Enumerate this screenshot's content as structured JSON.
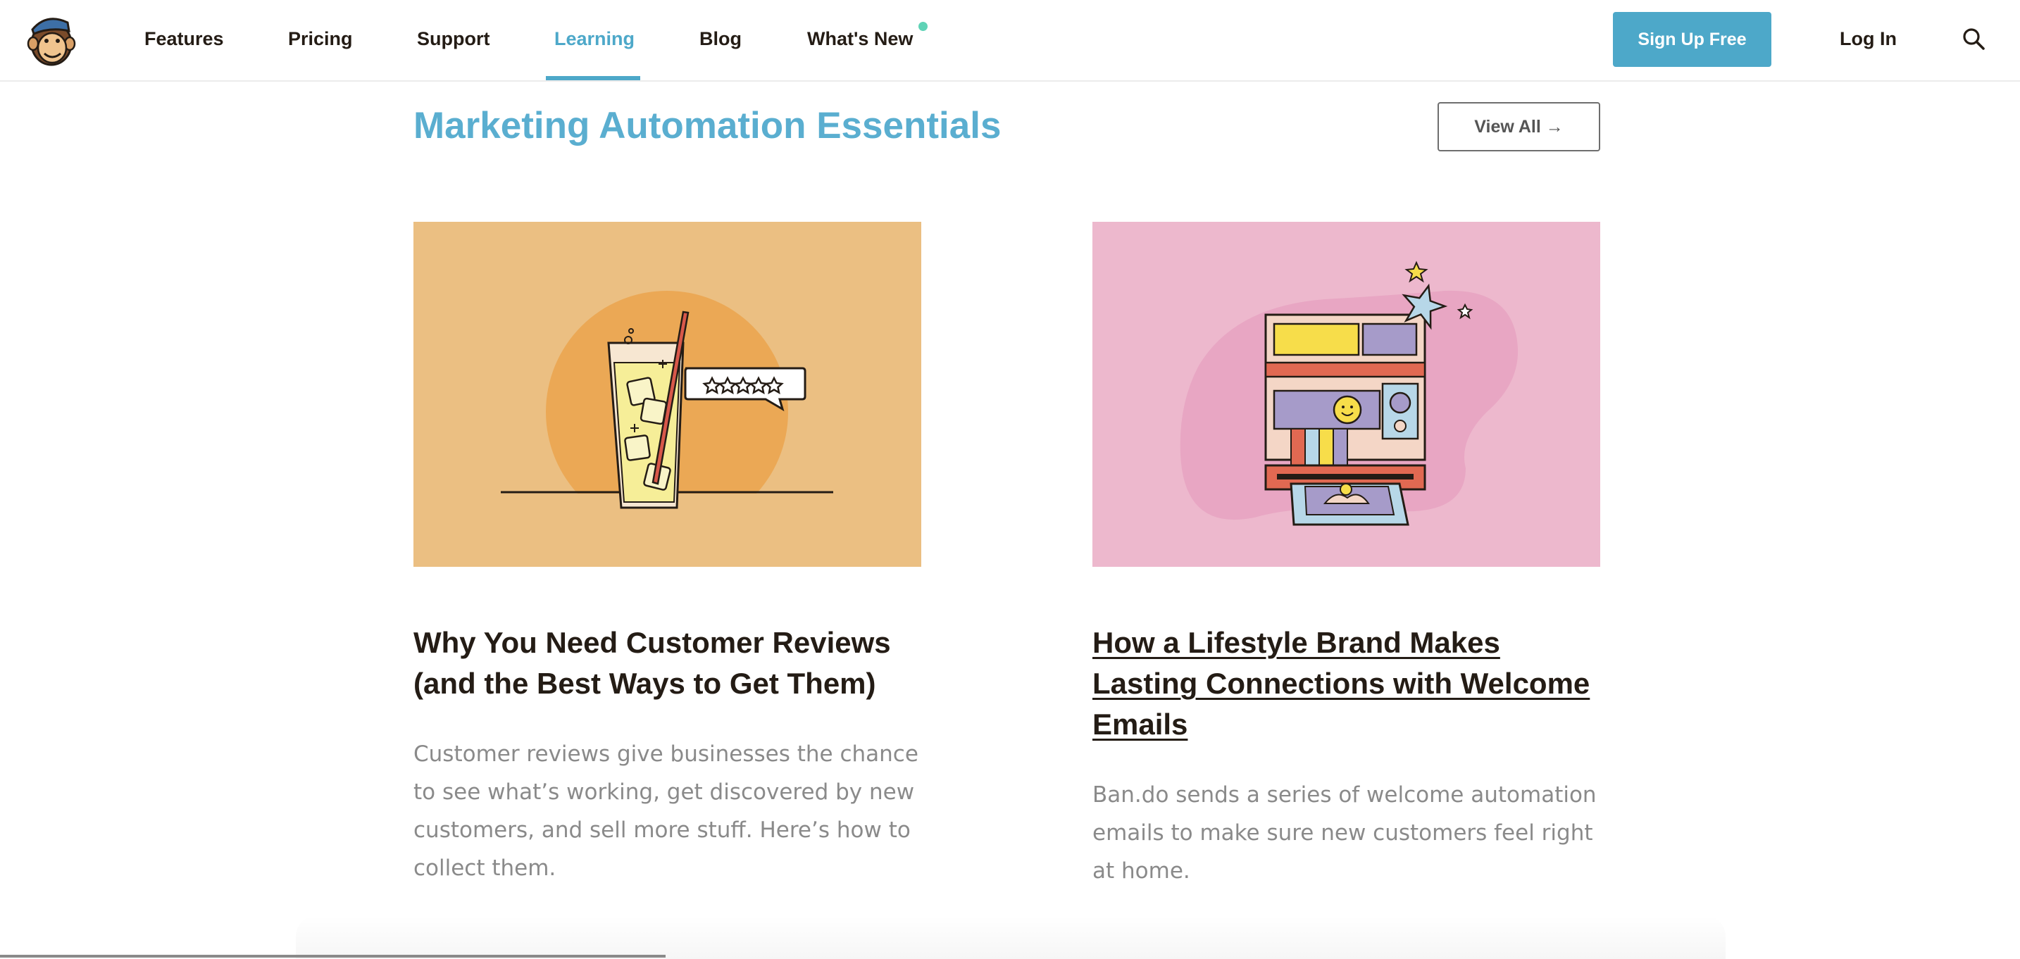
{
  "nav": {
    "logo_icon": "freddie-monkey-logo-icon",
    "links": [
      {
        "label": "Features"
      },
      {
        "label": "Pricing"
      },
      {
        "label": "Support"
      },
      {
        "label": "Learning",
        "active": true
      },
      {
        "label": "Blog"
      },
      {
        "label": "What's New",
        "has_new_dot": true
      }
    ],
    "signup_label": "Sign Up Free",
    "login_label": "Log In",
    "search_icon": "search-icon",
    "accent_color": "#4da8c9",
    "new_dot_color": "#5fd3b6"
  },
  "section": {
    "title": "Marketing Automation Essentials",
    "view_all_label": "View All →"
  },
  "cards": [
    {
      "image_icon": "lemonade-glass-with-review-stars-illustration",
      "image_bg": "#ebbf82",
      "title": "Why You Need Customer Reviews (and the Best Ways to Get Them)",
      "description": "Customer reviews give businesses the chance to see what’s working, get discovered by new customers, and sell more stuff. Here’s how to collect them."
    },
    {
      "image_icon": "instant-camera-printing-photo-illustration",
      "image_bg": "#edb8cd",
      "title": "How a Lifestyle Brand Makes Lasting Connections with Welcome Emails",
      "description": "Ban.do sends a series of welcome automation emails to make sure new customers feel right at home."
    }
  ]
}
